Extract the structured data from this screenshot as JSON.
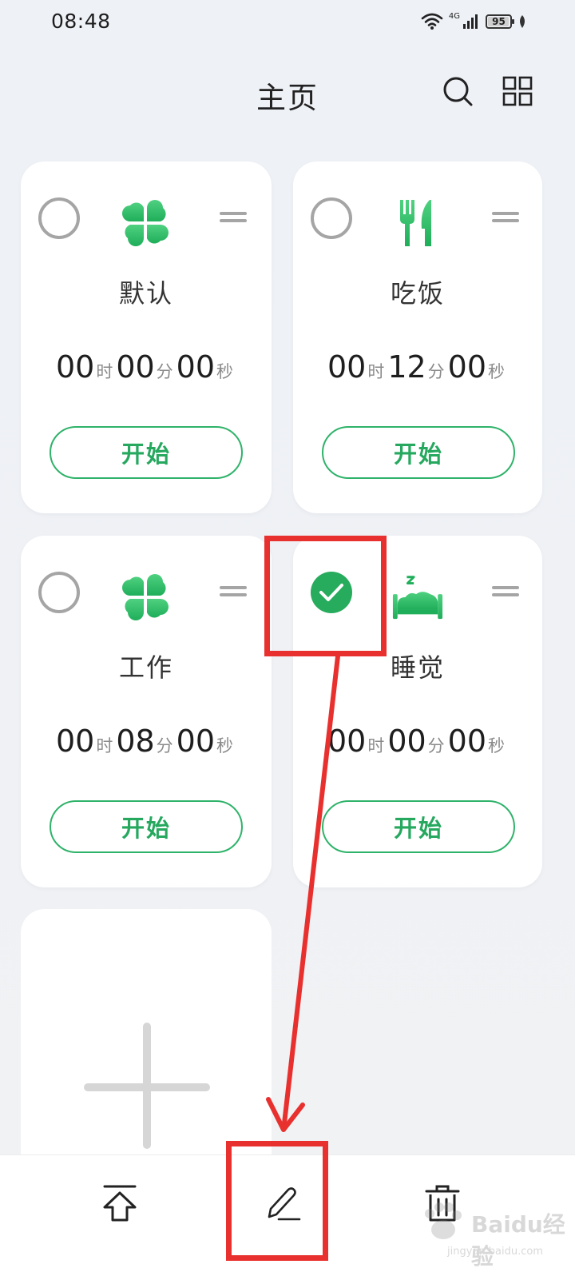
{
  "status_bar": {
    "time": "08:48",
    "network": "4G",
    "battery": "95",
    "battery_level": 0.95
  },
  "header": {
    "title": "主页",
    "search_icon": "search-icon",
    "apps_icon": "grid-icon"
  },
  "cards": [
    {
      "name": "默认",
      "icon": "clover-icon",
      "selected": false,
      "hours": "00",
      "minutes": "00",
      "seconds": "00",
      "start_label": "开始"
    },
    {
      "name": "吃饭",
      "icon": "fork-knife-icon",
      "selected": false,
      "hours": "00",
      "minutes": "12",
      "seconds": "00",
      "start_label": "开始"
    },
    {
      "name": "工作",
      "icon": "clover-icon",
      "selected": false,
      "hours": "00",
      "minutes": "08",
      "seconds": "00",
      "start_label": "开始"
    },
    {
      "name": "睡觉",
      "icon": "bed-icon",
      "selected": true,
      "hours": "00",
      "minutes": "00",
      "seconds": "00",
      "start_label": "开始"
    }
  ],
  "units": {
    "hour": "时",
    "minute": "分",
    "second": "秒"
  },
  "bottom_bar": {
    "items": [
      "move-to-top-icon",
      "edit-icon",
      "delete-icon"
    ]
  },
  "watermark": {
    "text": "Baidu经验",
    "url": "jingyan.baidu.com"
  },
  "colors": {
    "accent": "#27ab5c",
    "annotation": "#e8312f",
    "background": "#eef1f6"
  }
}
